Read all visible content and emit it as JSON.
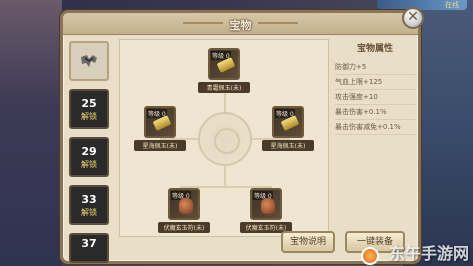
{
  "window": {
    "title": "宝物"
  },
  "hud": {
    "top_right_text": "在线"
  },
  "left_slots": [
    {
      "level": "",
      "status": "",
      "active": true,
      "icon": "treasure-icon"
    },
    {
      "level": "25",
      "status": "解锁",
      "active": false
    },
    {
      "level": "29",
      "status": "解锁",
      "active": false
    },
    {
      "level": "33",
      "status": "解锁",
      "active": false
    },
    {
      "level": "37",
      "status": "",
      "active": false
    }
  ],
  "center": {
    "items": [
      {
        "id": "top",
        "level": "等级 0",
        "name": "青霜佩玉(未)",
        "icon": "gold-ingot-icon"
      },
      {
        "id": "left",
        "level": "等级 0",
        "name": "星海佩玉(未)",
        "icon": "gold-ingot-icon"
      },
      {
        "id": "right",
        "level": "等级 0",
        "name": "星海佩玉(未)",
        "icon": "gold-ingot-icon"
      },
      {
        "id": "bottom-left",
        "level": "等级 0",
        "name": "伏魔玄玉符(未)",
        "icon": "pot-icon"
      },
      {
        "id": "bottom-right",
        "level": "等级 0",
        "name": "伏魔玄玉符(未)",
        "icon": "pot-icon"
      }
    ]
  },
  "attributes": {
    "title": "宝物属性",
    "items": [
      "防御力+5",
      "气血上限+125",
      "攻击强度+10",
      "暴击伤害+0.1%",
      "暴击伤害减免+0.1%"
    ]
  },
  "buttons": {
    "desc": "宝物说明",
    "equip": "一键装备"
  },
  "watermark": "东午手游网",
  "colors": {
    "panel_bg": "#e9dfc9",
    "panel_border": "#8a7457",
    "title_bg": "#c2b08c",
    "locked_slot": "#2a2a2a",
    "unlock_text": "#f2d96d"
  }
}
